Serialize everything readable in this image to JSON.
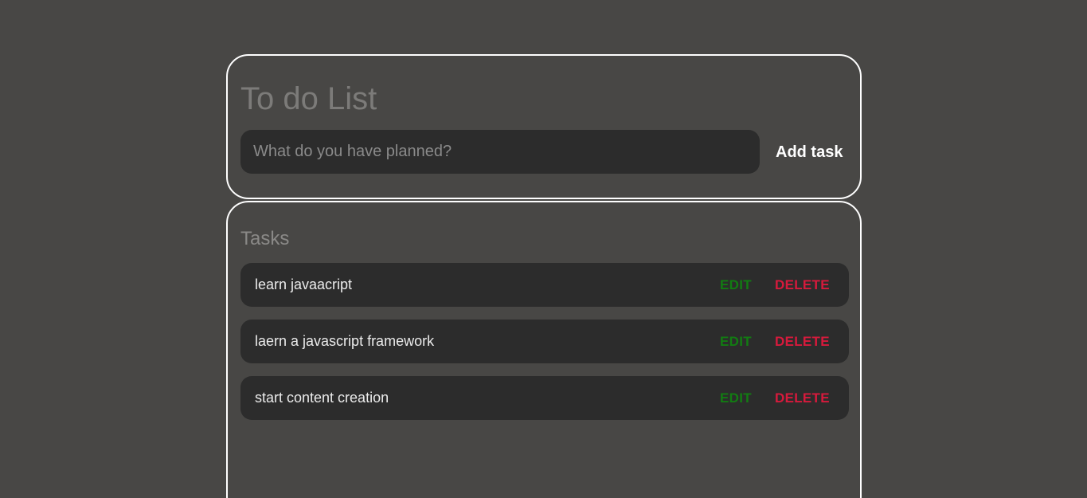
{
  "header": {
    "title": "To do List",
    "input": {
      "placeholder": "What do you have planned?",
      "value": ""
    },
    "add_label": "Add task"
  },
  "tasks": {
    "heading": "Tasks",
    "edit_label": "EDIT",
    "delete_label": "DELETE",
    "items": [
      {
        "text": "learn javaacript"
      },
      {
        "text": "laern a javascript framework"
      },
      {
        "text": "start content creation"
      }
    ]
  },
  "colors": {
    "background": "#484745",
    "card_border": "#ffffff",
    "row_background": "#2c2c2c",
    "edit": "#127c12",
    "delete": "#d71a3c"
  }
}
